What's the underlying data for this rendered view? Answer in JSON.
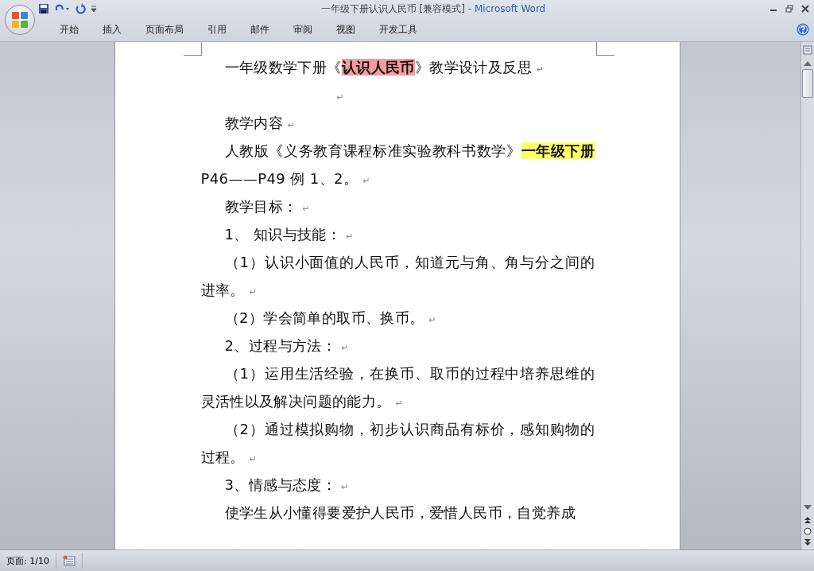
{
  "window": {
    "title": "一年级下册认识人民币 [兼容模式]",
    "separator": "-",
    "app": "Microsoft Word"
  },
  "ribbon_tabs": [
    {
      "label": "开始",
      "selected": false
    },
    {
      "label": "插入",
      "selected": false
    },
    {
      "label": "页面布局",
      "selected": false
    },
    {
      "label": "引用",
      "selected": false
    },
    {
      "label": "邮件",
      "selected": false
    },
    {
      "label": "审阅",
      "selected": false
    },
    {
      "label": "视图",
      "selected": false
    },
    {
      "label": "开发工具",
      "selected": false
    }
  ],
  "document": {
    "paragraphs": [
      {
        "kind": "body",
        "mark": "↵",
        "runs": [
          {
            "text": "一年级数学下册《"
          },
          {
            "text": "认识人民币",
            "bold": true,
            "color": "#f79c9c"
          },
          {
            "text": "》教学设计及反思"
          }
        ]
      },
      {
        "kind": "blank",
        "mark": "↵"
      },
      {
        "kind": "body",
        "mark": "↵",
        "runs": [
          {
            "text": "教学内容"
          }
        ]
      },
      {
        "kind": "body",
        "mark": "↵",
        "runs": [
          {
            "text": "人教版《义务教育课程标准实验教科书数学》"
          },
          {
            "text": "一年级下册",
            "bold": true,
            "color": "#ffff66"
          },
          {
            "text": " P46——P49 例 1、2。"
          }
        ]
      },
      {
        "kind": "body",
        "mark": "↵",
        "runs": [
          {
            "text": "教学目标："
          }
        ]
      },
      {
        "kind": "body",
        "mark": "↵",
        "runs": [
          {
            "text": "1、  知识与技能："
          }
        ]
      },
      {
        "kind": "body",
        "mark": "↵",
        "runs": [
          {
            "text": "（1）认识小面值的人民币，知道元与角、角与分之间的进率。"
          }
        ]
      },
      {
        "kind": "body",
        "mark": "↵",
        "runs": [
          {
            "text": "（2）学会简单的取币、换币。"
          }
        ]
      },
      {
        "kind": "body",
        "mark": "↵",
        "runs": [
          {
            "text": "2、过程与方法："
          }
        ]
      },
      {
        "kind": "body",
        "mark": "↵",
        "runs": [
          {
            "text": "（1）运用生活经验，在换币、取币的过程中培养思维的灵活性以及解决问题的能力。"
          }
        ]
      },
      {
        "kind": "body",
        "mark": "↵",
        "runs": [
          {
            "text": "（2）通过模拟购物，初步认识商品有标价，感知购物的过程。"
          }
        ]
      },
      {
        "kind": "body",
        "mark": "↵",
        "runs": [
          {
            "text": "3、情感与态度："
          }
        ]
      },
      {
        "kind": "body",
        "runs": [
          {
            "text": "使学生从小懂得要爱护人民币，爱惜人民币，自觉养成"
          }
        ]
      }
    ]
  },
  "status_bar": {
    "page": "页面: 1/10"
  }
}
